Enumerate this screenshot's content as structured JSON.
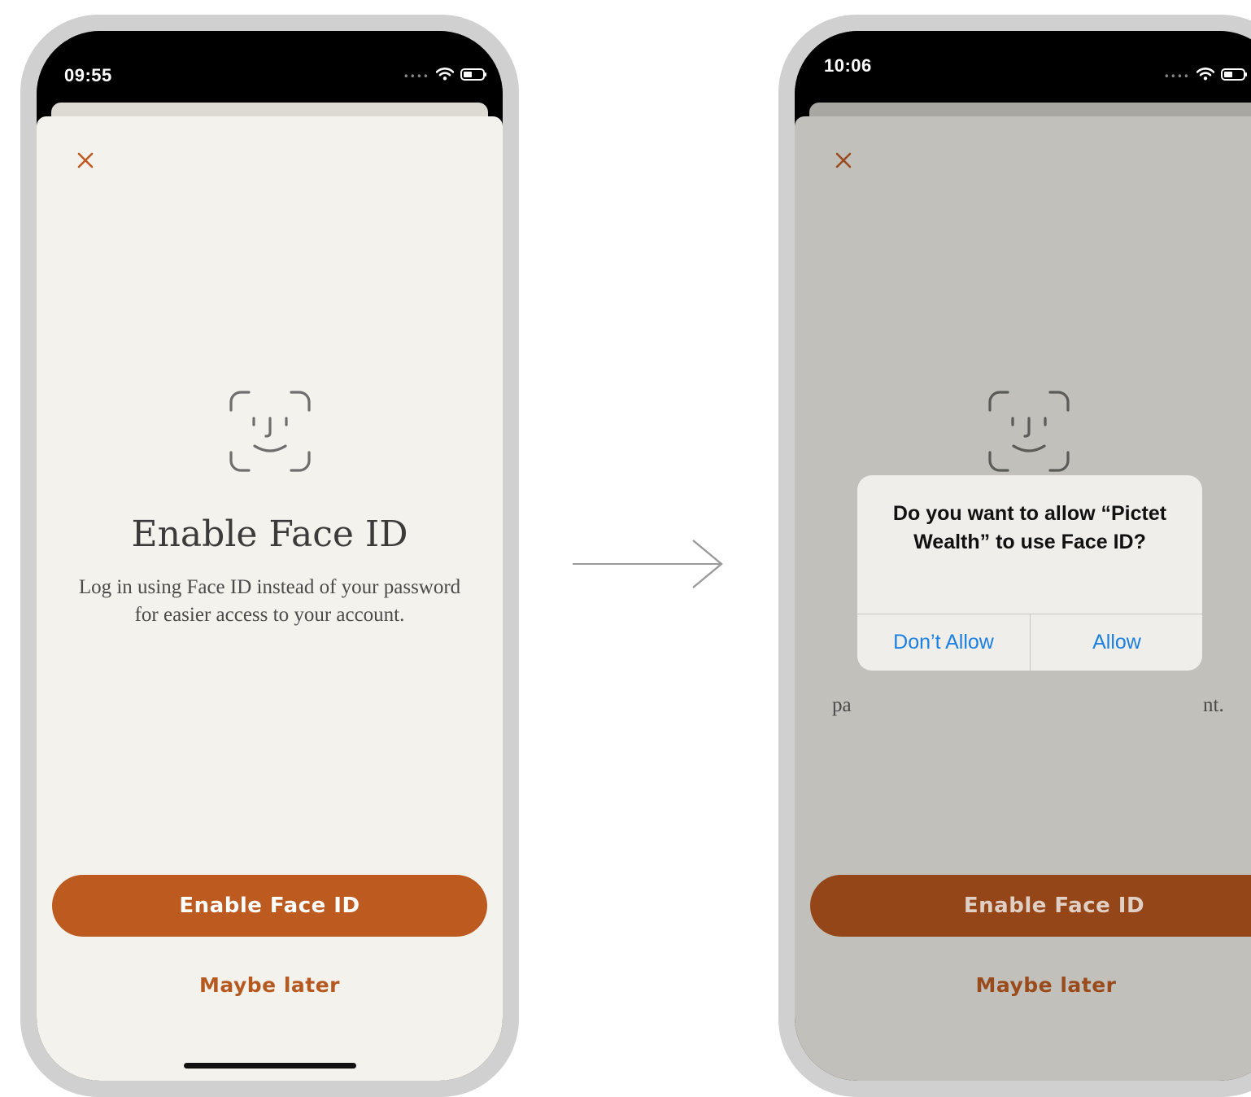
{
  "left_screen": {
    "time": "09:55",
    "title": "Enable Face ID",
    "subtitle": "Log in using Face ID instead of your password for easier access to your account.",
    "primary_button": "Enable Face ID",
    "secondary_button": "Maybe later"
  },
  "right_screen": {
    "time": "10:06",
    "primary_button": "Enable Face ID",
    "secondary_button": "Maybe later",
    "partial_left": "pa",
    "partial_right": "nt.",
    "alert": {
      "title": "Do you want to allow “Pictet Wealth” to use Face ID?",
      "deny_label": "Don’t Allow",
      "allow_label": "Allow"
    }
  },
  "icons": {
    "signal": "signal-dots-icon",
    "wifi": "wifi-icon",
    "battery": "battery-icon",
    "close": "close-icon",
    "faceid": "face-id-icon",
    "flow": "right-arrow-icon"
  },
  "colors": {
    "accent": "#bd5a20",
    "accent_dimmed": "#954618",
    "sheet_background": "#f4f2ec",
    "dimmed_background": "#c2c0bb",
    "alert_button": "#1a7fe0"
  }
}
